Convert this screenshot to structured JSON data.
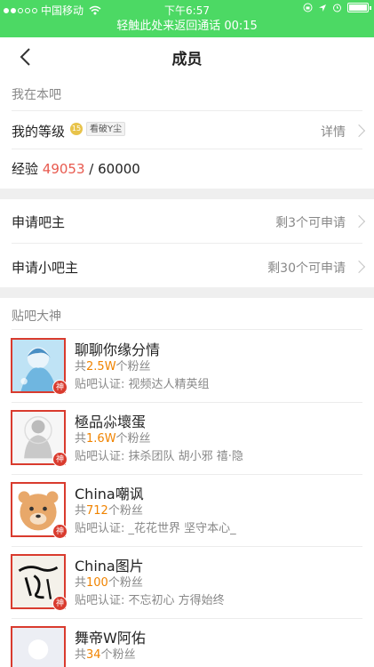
{
  "status_bar": {
    "carrier": "中国移动",
    "time": "下午6:57"
  },
  "call_banner": "轻触此处来返回通话 00:15",
  "nav": {
    "title": "成员"
  },
  "my_section": {
    "header": "我在本吧",
    "level_label": "我的等级",
    "level_num": "15",
    "level_name": "看破Y尘",
    "detail": "详情",
    "xp_label": "经验",
    "xp_current": "49053",
    "xp_total": "/ 60000"
  },
  "applications": [
    {
      "label": "申请吧主",
      "status": "剩3个可申请"
    },
    {
      "label": "申请小吧主",
      "status": "剩30个可申请"
    }
  ],
  "gods_section": {
    "header": "贴吧大神",
    "badge": "神",
    "fans_prefix": "共",
    "fans_suffix": "个粉丝",
    "cert_prefix": "贴吧认证: ",
    "items": [
      {
        "name": "聊聊你缘分情",
        "fans": "2.5W",
        "cert": "视频达人精英组"
      },
      {
        "name": "極品尛壞蛋",
        "fans": "1.6W",
        "cert": "抹杀团队  胡小邪  禧·隐"
      },
      {
        "name": "China嘲讽",
        "fans": "712",
        "cert": "_花花世界 坚守本心_"
      },
      {
        "name": "China图片",
        "fans": "100",
        "cert": "不忘初心 方得始终"
      },
      {
        "name": "舞帝W阿佑",
        "fans": "34",
        "cert": ""
      }
    ]
  }
}
